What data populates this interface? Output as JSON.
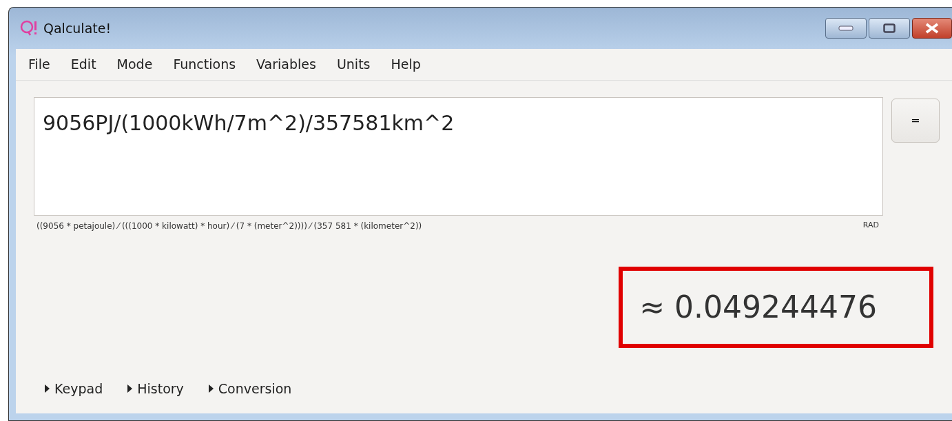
{
  "window": {
    "title": "Qalculate!"
  },
  "menu": [
    {
      "label": "File"
    },
    {
      "label": "Edit"
    },
    {
      "label": "Mode"
    },
    {
      "label": "Functions"
    },
    {
      "label": "Variables"
    },
    {
      "label": "Units"
    },
    {
      "label": "Help"
    }
  ],
  "expression": {
    "value": "9056PJ/(1000kWh/7m^2)/357581km^2"
  },
  "equals_button": "=",
  "parsed": "((9056 * petajoule) ⁄ (((1000 * kilowatt) * hour) ⁄ (7 * (meter^2)))) ⁄ (357 581 * (kilometer^2))",
  "angle_mode": "RAD",
  "result": {
    "text": "≈ 0.049244476",
    "highlighted": true
  },
  "expanders": [
    {
      "label": "Keypad",
      "expanded": false
    },
    {
      "label": "History",
      "expanded": false
    },
    {
      "label": "Conversion",
      "expanded": false
    }
  ]
}
